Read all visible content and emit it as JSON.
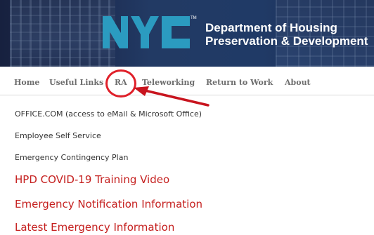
{
  "banner": {
    "logo_text": "NYC",
    "trademark": "TM",
    "dept_line1": "Department of Housing",
    "dept_line2": "Preservation & Development"
  },
  "nav": {
    "items": [
      "Home",
      "Useful Links",
      "RA",
      "Teleworking",
      "Return to Work",
      "About"
    ],
    "highlighted": "RA",
    "highlight_color": "#e0202a"
  },
  "links": [
    "OFFICE.COM (access to eMail & Microsoft Office)",
    "Employee Self Service",
    "Emergency Contingency Plan",
    "HPD COVID-19 Training Video",
    "Emergency Notification Information",
    "Latest Emergency Information"
  ],
  "colors": {
    "banner_bg": "#1f3158",
    "logo_fill": "#2b9bc0",
    "nav_text": "#6d6d6d",
    "link_text": "#333333",
    "alert_link": "#c5201f"
  }
}
